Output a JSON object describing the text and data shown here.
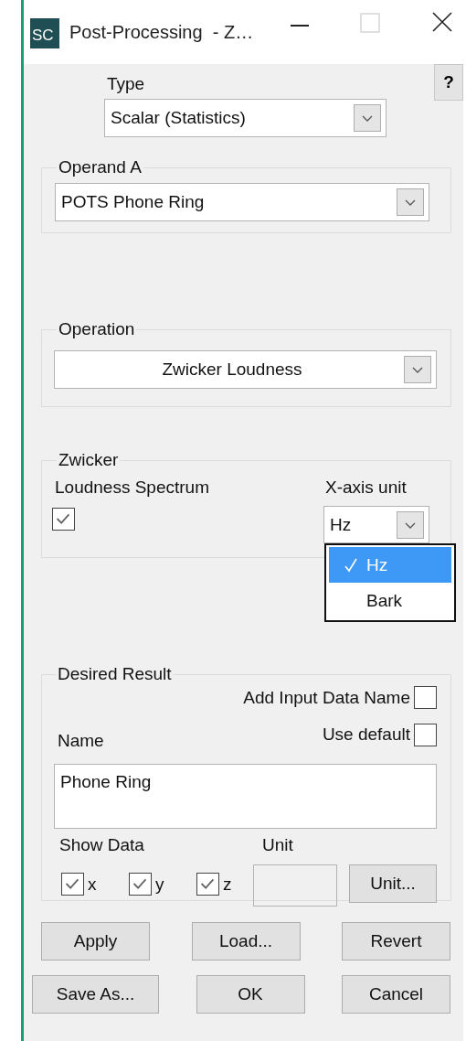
{
  "window": {
    "icon_label": "SC",
    "title": "Post-Processing  - Z…",
    "help_button": "?"
  },
  "type": {
    "label": "Type",
    "value": "Scalar (Statistics)"
  },
  "operand_a": {
    "title": "Operand A",
    "value": "POTS Phone Ring"
  },
  "operation": {
    "title": "Operation",
    "value": "Zwicker Loudness"
  },
  "zwicker": {
    "title": "Zwicker",
    "loudness_spectrum": {
      "label": "Loudness Spectrum",
      "checked": true
    },
    "x_axis_unit": {
      "label": "X-axis unit",
      "value": "Hz",
      "expanded": true,
      "options": [
        {
          "label": "Hz",
          "selected": true
        },
        {
          "label": "Bark",
          "selected": false
        }
      ]
    }
  },
  "desired_result": {
    "title": "Desired Result",
    "add_input_data_name": {
      "label": "Add Input Data Name",
      "checked": false
    },
    "use_default": {
      "label": "Use default",
      "checked": false
    },
    "name_label": "Name",
    "name_value": "Phone Ring",
    "show_data_label": "Show Data",
    "show_data": [
      {
        "label": "x",
        "checked": true
      },
      {
        "label": "y",
        "checked": true
      },
      {
        "label": "z",
        "checked": true
      }
    ],
    "unit_label": "Unit",
    "unit_button": "Unit..."
  },
  "buttons": [
    [
      "Apply",
      "Load...",
      "Revert"
    ],
    [
      "Save As...",
      "OK",
      "Cancel"
    ]
  ]
}
